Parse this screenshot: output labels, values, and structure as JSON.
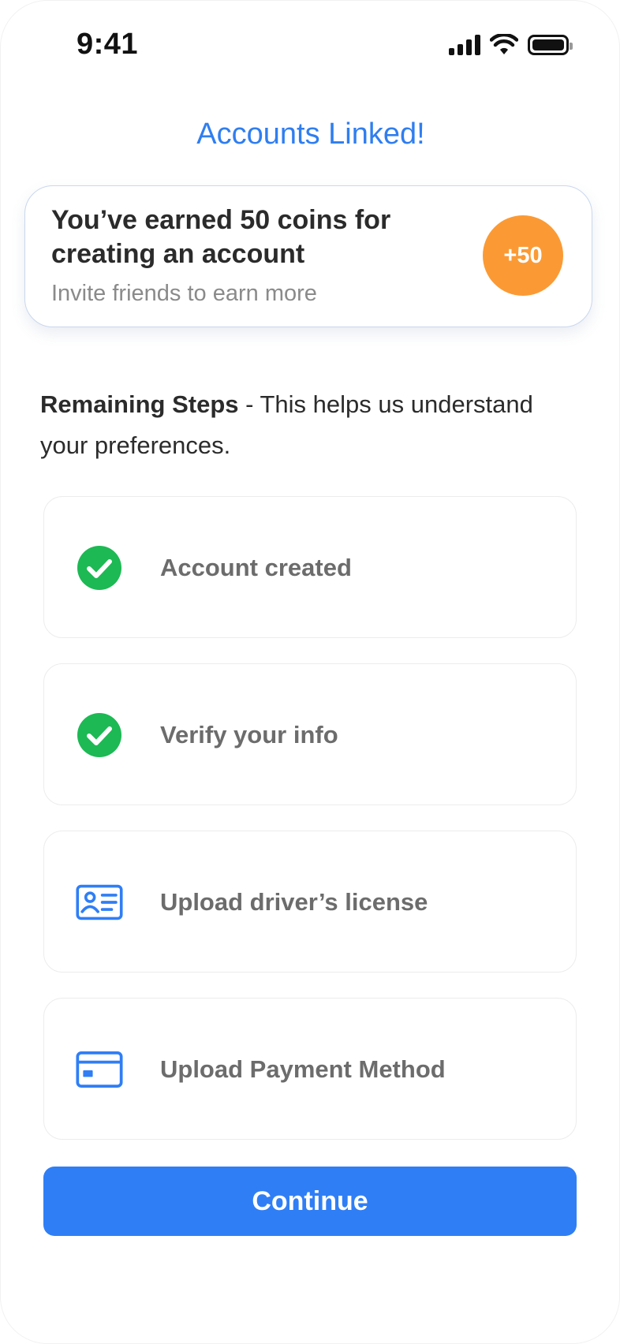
{
  "status_bar": {
    "time": "9:41"
  },
  "header": {
    "title": "Accounts Linked!"
  },
  "reward": {
    "title": "You’ve earned 50 coins for creating an account",
    "subtitle": "Invite friends to earn more",
    "badge": "+50",
    "badge_color": "#FB9A34"
  },
  "remaining": {
    "heading": "Remaining Steps",
    "description": " - This helps us understand your preferences."
  },
  "steps": [
    {
      "label": "Account created",
      "icon": "check-circle-icon",
      "completed": true
    },
    {
      "label": "Verify your info",
      "icon": "check-circle-icon",
      "completed": true
    },
    {
      "label": "Upload driver’s license",
      "icon": "id-card-icon",
      "completed": false
    },
    {
      "label": "Upload Payment Method",
      "icon": "credit-card-icon",
      "completed": false
    }
  ],
  "footer": {
    "continue_label": "Continue"
  },
  "colors": {
    "accent": "#2F7EF6",
    "success": "#1DB954",
    "text": "#2B2B2B"
  }
}
